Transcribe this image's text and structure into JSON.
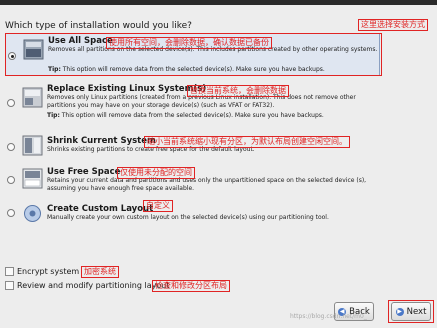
{
  "question": "Which type of installation would you like?",
  "options": [
    {
      "title": "Use All Space",
      "desc": "Removes all partitions on the selected device(s).  This includes partitions created by other operating systems.",
      "tip_label": "Tip:",
      "tip_text": "This option will remove data from the selected device(s).  Make sure you have backups.",
      "selected": true
    },
    {
      "title": "Replace Existing Linux System(s)",
      "desc": "Removes only Linux partitions (created from a previous Linux installation).  This does not remove other partitions you may have on your storage device(s) (such as VFAT or FAT32).",
      "tip_label": "Tip:",
      "tip_text": "This option will remove data from the selected device(s).  Make sure you have backups.",
      "selected": false
    },
    {
      "title": "Shrink Current System",
      "desc": "Shrinks existing partitions to create free space for the default layout.",
      "selected": false
    },
    {
      "title": "Use Free Space",
      "desc": "Retains your current data and partitions and uses only the unpartitioned space on the selected device (s), assuming you have enough free space available.",
      "selected": false
    },
    {
      "title": "Create Custom Layout",
      "desc": "Manually create your own custom layout on the selected device(s) using our partitioning tool.",
      "selected": false
    }
  ],
  "checkboxes": {
    "encrypt": "Encrypt system",
    "review": "Review and modify partitioning layout"
  },
  "buttons": {
    "back": "Back",
    "next": "Next"
  },
  "annotations": {
    "install_type": "这里选择安装方式",
    "use_all": "使用所有空间，会删除数据，确认数据已备份",
    "replace": "替换当前系统，会删除数据",
    "shrink": "缩小当前系统缩小现有分区，为默认布局创建空闲空间。",
    "free": "仅使用未分配的空间",
    "custom": "自定义",
    "encrypt": "加密系统",
    "review": "检查和修改分区布局"
  },
  "watermark": "https://blog.csdn.net/m0_",
  "colors": {
    "annotation": "#e02424",
    "selected_bg": "#dfe6f1"
  }
}
